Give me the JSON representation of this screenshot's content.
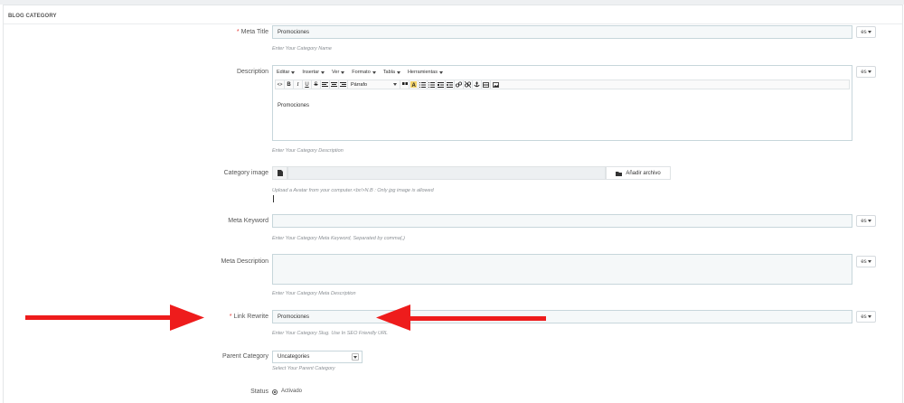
{
  "panel": {
    "title": "BLOG CATEGORY"
  },
  "meta_title": {
    "required": "*",
    "label": "Meta Title",
    "value": "Promociones",
    "lang": "es",
    "help": "Enter Your Category Name"
  },
  "description": {
    "label": "Description",
    "lang": "es",
    "menus": [
      "Editar",
      "Insertar",
      "Ver",
      "Formato",
      "Tabla",
      "Herramientas"
    ],
    "toolbar": {
      "source": "<>",
      "bold": "B",
      "italic": "I",
      "underline": "U",
      "strike": "S",
      "format_select": "Párrafo"
    },
    "content": "Promociones",
    "help": "Enter Your Category Description"
  },
  "category_image": {
    "label": "Category image",
    "button": "Añadir archivo",
    "help": "Upload a Avatar from your computer.<br/>N.B : Only jpg image is allowed"
  },
  "meta_keyword": {
    "label": "Meta Keyword",
    "lang": "es",
    "help": "Enter Your Category Meta Keyword, Separated by comma(,)"
  },
  "meta_description": {
    "label": "Meta Description",
    "lang": "es",
    "help": "Enter Your Category Meta Description"
  },
  "link_rewrite": {
    "required": "*",
    "label": "Link Rewrite",
    "value": "Promociones",
    "lang": "es",
    "help": "Enter Your Category Slug. Use In SEO Friendly URL"
  },
  "parent_category": {
    "label": "Parent Category",
    "value": "Uncategories",
    "help": "Select Your Parent Category"
  },
  "status": {
    "label": "Status",
    "option": "Activado"
  },
  "colors": {
    "accent_arrow": "#ee1c1c",
    "required": "#e53935",
    "field_bg": "#f5f8f9"
  }
}
